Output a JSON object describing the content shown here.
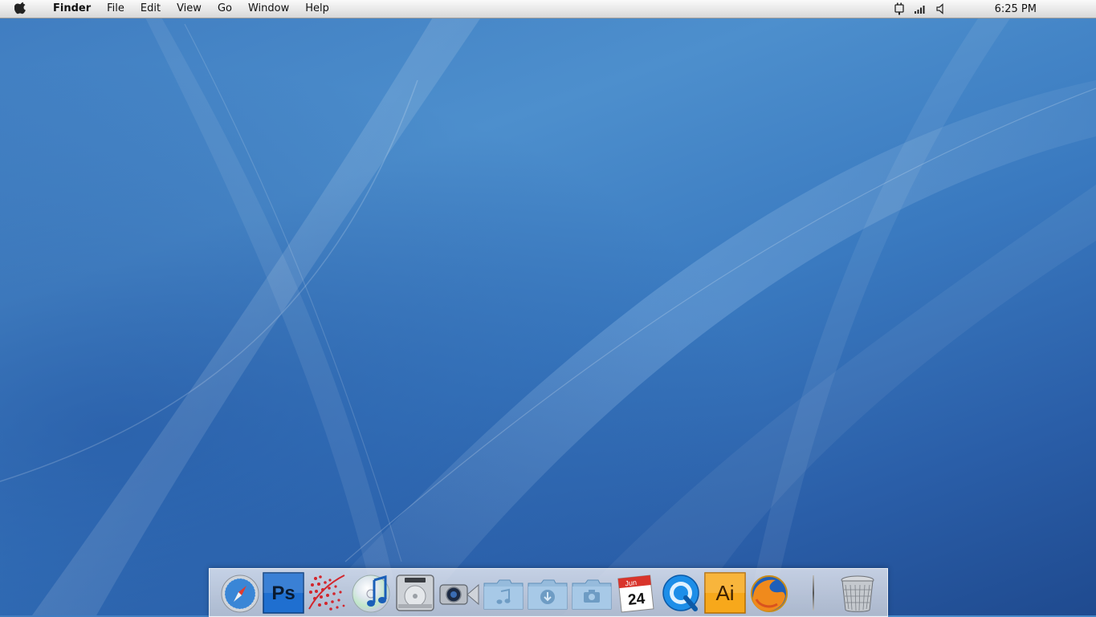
{
  "menubar": {
    "app_name": "Finder",
    "items": [
      {
        "label": "File"
      },
      {
        "label": "Edit"
      },
      {
        "label": "View"
      },
      {
        "label": "Go"
      },
      {
        "label": "Window"
      },
      {
        "label": "Help"
      }
    ],
    "status_icons": [
      "power-plug-icon",
      "signal-bars-icon",
      "volume-icon"
    ],
    "clock": "6:25 PM"
  },
  "dock": {
    "items": [
      {
        "name": "safari-icon"
      },
      {
        "name": "photoshop-icon",
        "text": "Ps"
      },
      {
        "name": "dotted-swoosh-app-icon"
      },
      {
        "name": "itunes-icon"
      },
      {
        "name": "hard-drive-icon"
      },
      {
        "name": "facetime-camera-icon"
      },
      {
        "name": "music-folder-icon"
      },
      {
        "name": "downloads-folder-icon"
      },
      {
        "name": "pictures-folder-icon"
      },
      {
        "name": "ical-calendar-icon",
        "month": "Jun",
        "day": "24"
      },
      {
        "name": "quicktime-icon"
      },
      {
        "name": "illustrator-icon",
        "text": "Ai"
      },
      {
        "name": "firefox-icon"
      },
      {
        "name": "trash-icon"
      }
    ]
  },
  "colors": {
    "desktop": "#3f7cc0",
    "menubar": "#e6e6e6",
    "photoshop": "#1f6fd0",
    "illustrator": "#f7a81b"
  }
}
